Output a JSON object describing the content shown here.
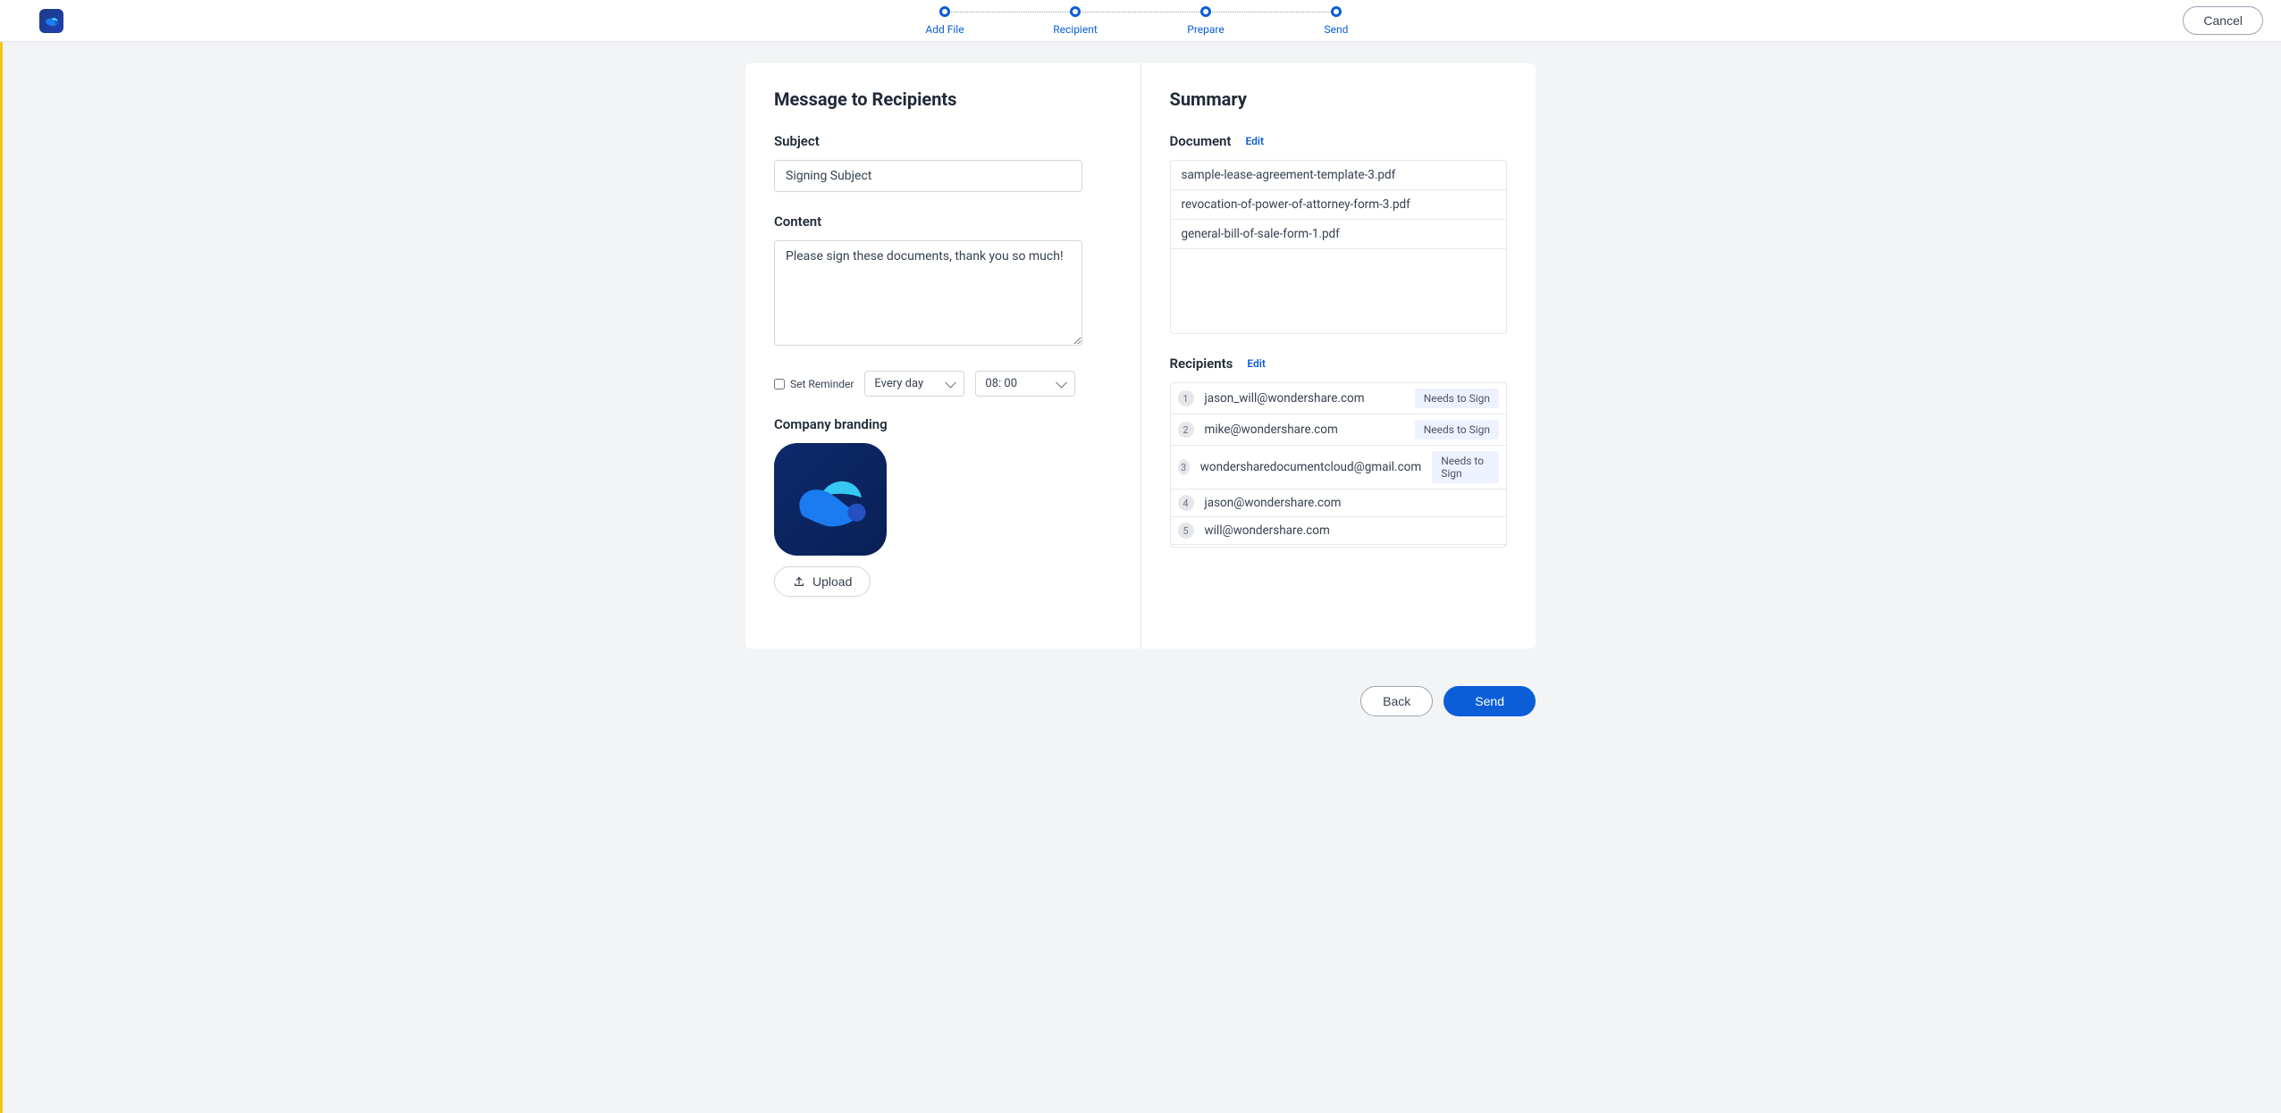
{
  "steps": [
    "Add File",
    "Recipient",
    "Prepare",
    "Send"
  ],
  "header": {
    "cancel": "Cancel"
  },
  "left": {
    "title": "Message to Recipients",
    "subject_label": "Subject",
    "subject_value": "Signing Subject",
    "content_label": "Content",
    "content_value": "Please sign these documents, thank you so much!",
    "set_reminder_label": "Set Reminder",
    "reminder_freq": "Every day",
    "reminder_time": "08: 00",
    "branding_label": "Company branding",
    "upload_label": "Upload"
  },
  "right": {
    "title": "Summary",
    "document_label": "Document",
    "edit_label": "Edit",
    "documents": [
      "sample-lease-agreement-template-3.pdf",
      "revocation-of-power-of-attorney-form-3.pdf",
      "general-bill-of-sale-form-1.pdf"
    ],
    "recipients_label": "Recipients",
    "recipients": [
      {
        "n": "1",
        "email": "jason_will@wondershare.com",
        "badge": "Needs to Sign"
      },
      {
        "n": "2",
        "email": "mike@wondershare.com",
        "badge": "Needs to Sign"
      },
      {
        "n": "3",
        "email": "wondersharedocumentcloud@gmail.com",
        "badge": "Needs to Sign"
      },
      {
        "n": "4",
        "email": "jason@wondershare.com",
        "badge": ""
      },
      {
        "n": "5",
        "email": "will@wondershare.com",
        "badge": ""
      }
    ]
  },
  "footer": {
    "back": "Back",
    "send": "Send"
  }
}
